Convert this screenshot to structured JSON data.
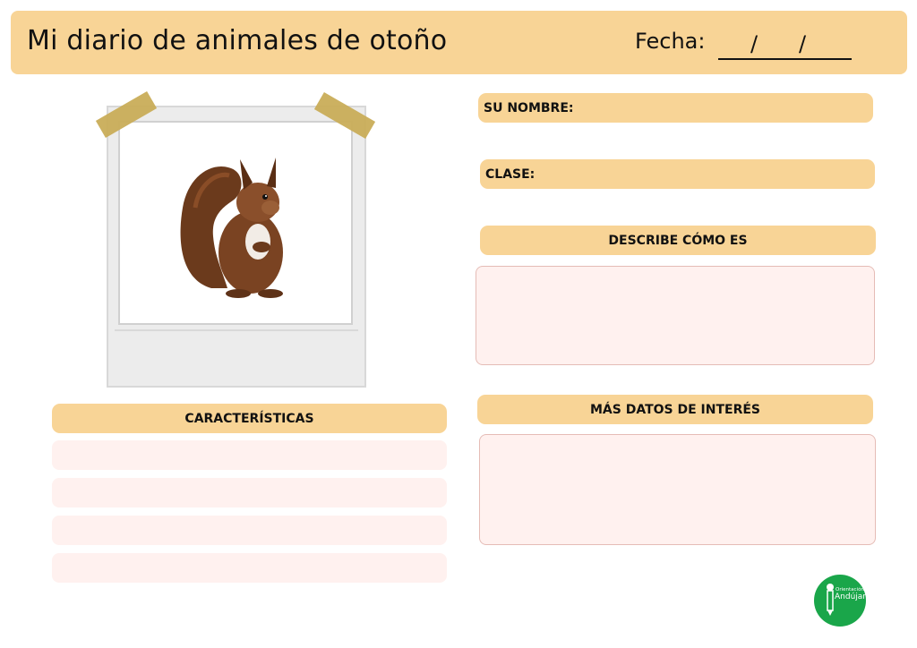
{
  "header": {
    "title": "Mi diario de animales de otoño",
    "date_label": "Fecha:",
    "date_separator": "/"
  },
  "photo": {
    "subject_icon": "squirrel-icon"
  },
  "fields": {
    "name_label": "SU NOMBRE:",
    "class_label": "CLASE:",
    "describe_label": "DESCRIBE CÓMO ES",
    "more_data_label": "MÁS DATOS DE INTERÉS",
    "characteristics_label": "CARACTERÍSTICAS"
  },
  "logo": {
    "line1": "Orientación",
    "line2": "Andújar",
    "icon": "pencil-icon"
  },
  "colors": {
    "header_bg": "#f8d496",
    "field_bg": "#fff1ef",
    "logo_green": "#1aa64a"
  }
}
